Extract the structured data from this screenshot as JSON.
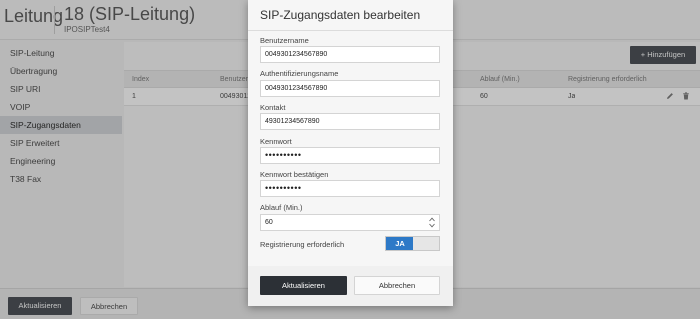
{
  "header": {
    "section": "Leitung",
    "title": "18 (SIP-Leitung)",
    "subtitle": "IPOSIPTest4"
  },
  "sidebar": {
    "items": [
      {
        "label": "SIP-Leitung"
      },
      {
        "label": "Übertragung"
      },
      {
        "label": "SIP URI"
      },
      {
        "label": "VOIP"
      },
      {
        "label": "SIP-Zugangsdaten",
        "active": true
      },
      {
        "label": "SIP Erweitert"
      },
      {
        "label": "Engineering"
      },
      {
        "label": "T38 Fax"
      }
    ]
  },
  "content": {
    "add_label": "+ Hinzufügen",
    "table": {
      "columns": [
        "Index",
        "Benutzer",
        "Ablauf (Min.)",
        "Registrierung erforderlich"
      ],
      "rows": [
        {
          "index": "1",
          "user": "00493012345",
          "expiry": "60",
          "registration": "Ja"
        }
      ]
    }
  },
  "footer": {
    "update_label": "Aktualisieren",
    "cancel_label": "Abbrechen"
  },
  "modal": {
    "title": "SIP-Zugangsdaten bearbeiten",
    "fields": {
      "username": {
        "label": "Benutzername",
        "value": "0049301234567890"
      },
      "auth_name": {
        "label": "Authentifizierungsname",
        "value": "0049301234567890"
      },
      "contact": {
        "label": "Kontakt",
        "value": "49301234567890"
      },
      "password": {
        "label": "Kennwort",
        "value": "••••••••••"
      },
      "password_confirm": {
        "label": "Kennwort bestätigen",
        "value": "••••••••••"
      },
      "expiry": {
        "label": "Ablauf (Min.)",
        "value": "60"
      },
      "registration": {
        "label": "Registrierung erforderlich",
        "value": "JA"
      }
    },
    "update_label": "Aktualisieren",
    "cancel_label": "Abbrechen"
  },
  "colors": {
    "toggle_on": "#2d79c7",
    "primary_button": "#2c3036"
  }
}
